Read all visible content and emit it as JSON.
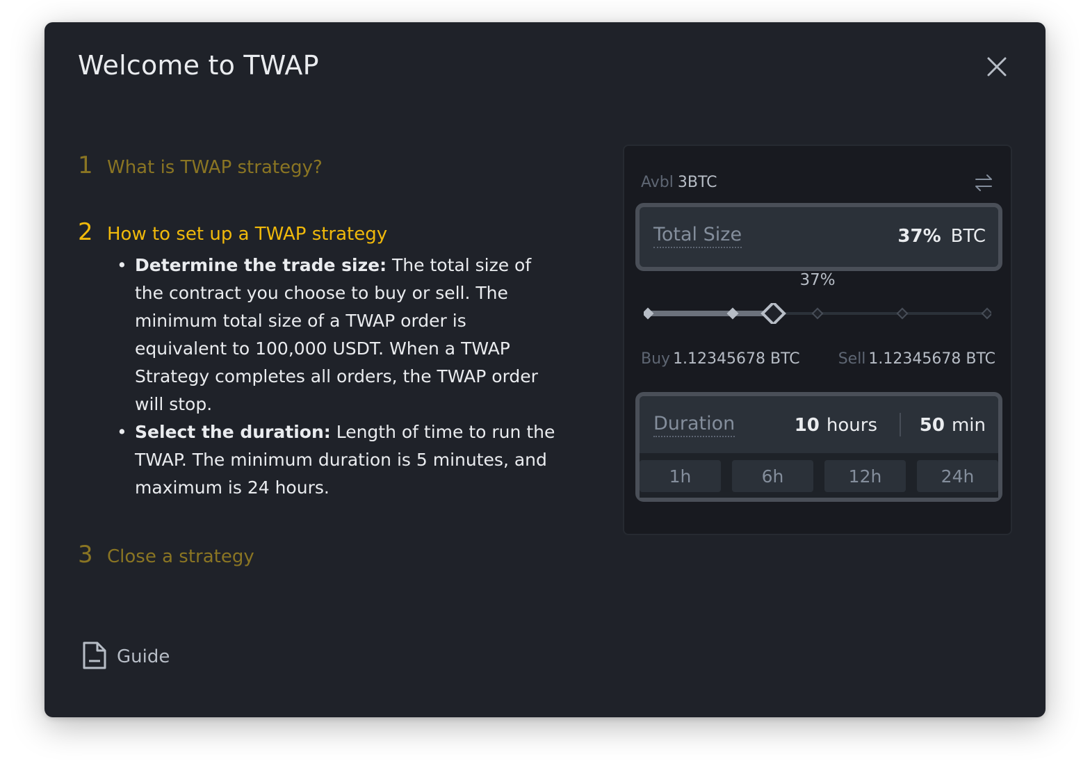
{
  "modal": {
    "title": "Welcome to TWAP"
  },
  "steps": [
    {
      "num": "1",
      "title": "What is TWAP strategy?",
      "state": "collapsed"
    },
    {
      "num": "2",
      "title": "How to set up a TWAP strategy",
      "state": "expanded"
    },
    {
      "num": "3",
      "title": "Close a strategy",
      "state": "collapsed"
    }
  ],
  "details": {
    "b1_bold": "Determine the trade size:",
    "b1_text": " The total size of the contract you choose to buy or sell. The minimum total size of a TWAP order is equivalent to 100,000 USDT. When a TWAP Strategy completes all orders, the TWAP order will stop.",
    "b2_bold": "Select the duration:",
    "b2_text": " Length of time to run the TWAP. The minimum duration is 5 minutes, and maximum is 24 hours."
  },
  "guide": {
    "label": "Guide",
    "icon": "document-icon"
  },
  "preview": {
    "avbl_label": "Avbl",
    "avbl_value": "3BTC",
    "total_size_label": "Total Size",
    "total_size_value": "37%",
    "total_size_unit": "BTC",
    "slider_label": "37%",
    "slider_value": 0.37,
    "buy_label": "Buy",
    "buy_value": "1.12345678 BTC",
    "sell_label": "Sell",
    "sell_value": "1.12345678 BTC",
    "duration_label": "Duration",
    "duration_hours": "10",
    "duration_hours_unit": "hours",
    "duration_mins": "50",
    "duration_mins_unit": "min",
    "presets": [
      "1h",
      "6h",
      "12h",
      "24h"
    ]
  },
  "colors": {
    "accent": "#f0b90b",
    "accent_muted": "#8a7523",
    "bg": "#1f2229"
  }
}
